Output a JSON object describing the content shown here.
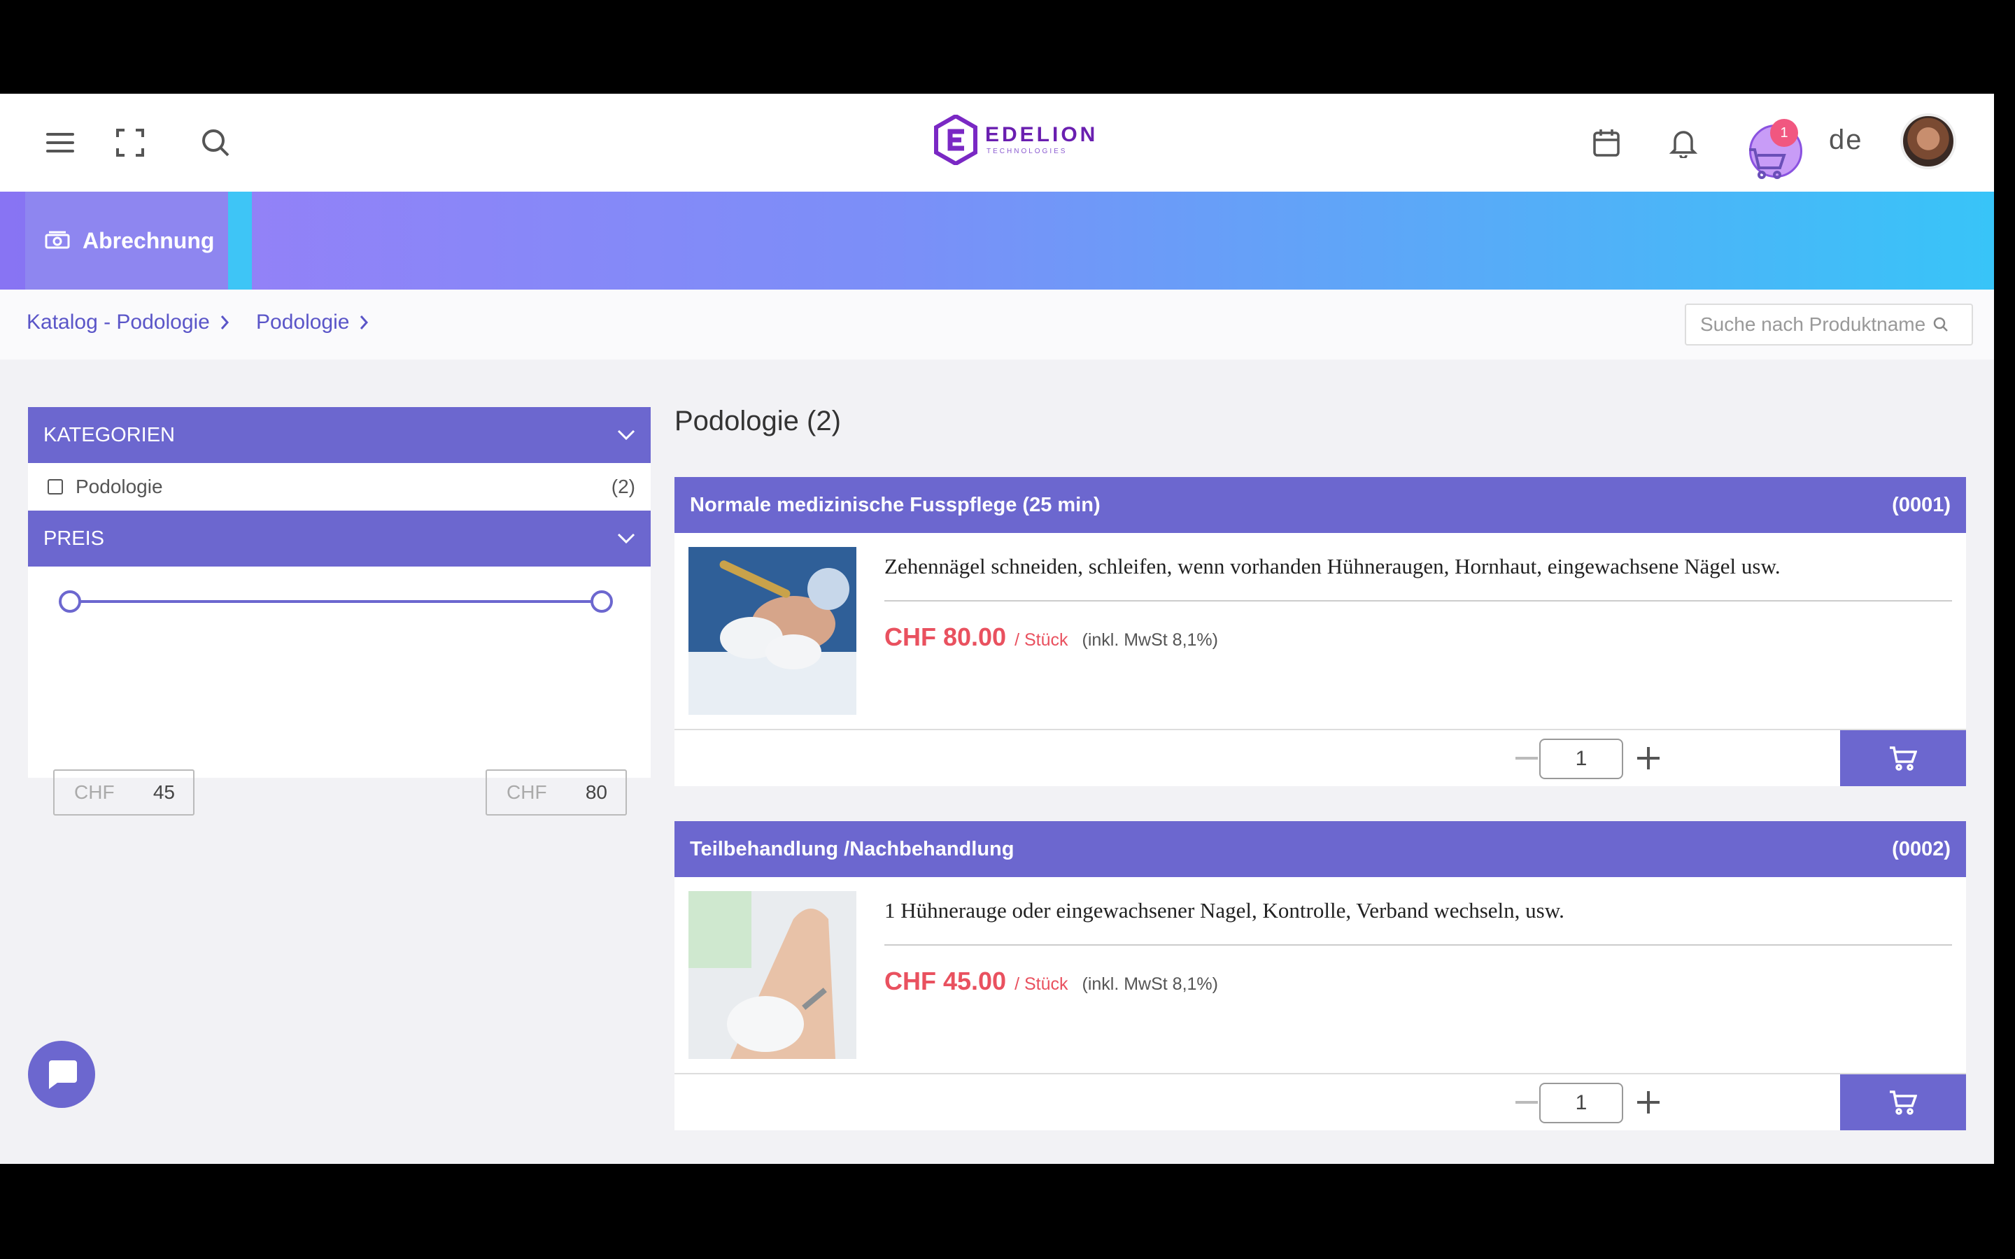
{
  "header": {
    "logo_name": "EDELION",
    "logo_sub": "TECHNOLOGIES",
    "cart_badge": "1",
    "language": "de",
    "icons": [
      "menu-icon",
      "fullscreen-icon",
      "search-icon",
      "calendar-icon",
      "bell-icon",
      "cart-icon",
      "avatar"
    ]
  },
  "banner": {
    "label": "Abrechnung",
    "icon": "cash-icon"
  },
  "breadcrumb": [
    {
      "label": "Katalog - Podologie"
    },
    {
      "label": "Podologie"
    }
  ],
  "search": {
    "placeholder": "Suche nach Produktname"
  },
  "filters": {
    "categories_title": "KATEGORIEN",
    "categories": [
      {
        "label": "Podologie",
        "count": "(2)",
        "checked": false
      }
    ],
    "price_title": "PREIS",
    "price_min": {
      "currency": "CHF",
      "value": "45"
    },
    "price_max": {
      "currency": "CHF",
      "value": "80"
    }
  },
  "section_title": "Podologie (2)",
  "products": [
    {
      "title": "Normale medizinische Fusspflege (25 min)",
      "code": "(0001)",
      "description": "Zehennägel schneiden, schleifen, wenn vorhanden Hühneraugen, Hornhaut, eingewachsene Nägel usw.",
      "price": "CHF 80.00",
      "unit": "/ Stück",
      "vat": "(inkl. MwSt 8,1%)",
      "quantity": "1"
    },
    {
      "title": "Teilbehandlung /Nachbehandlung",
      "code": "(0002)",
      "description": "1 Hühnerauge oder eingewachsener Nagel, Kontrolle, Verband wechseln, usw.",
      "price": "CHF 45.00",
      "unit": "/ Stück",
      "vat": "(inkl. MwSt 8,1%)",
      "quantity": "1"
    }
  ],
  "colors": {
    "primary": "#6c67cf",
    "price": "#e9515f",
    "banner_start": "#9b7cf7",
    "banner_end": "#38c4f8"
  }
}
